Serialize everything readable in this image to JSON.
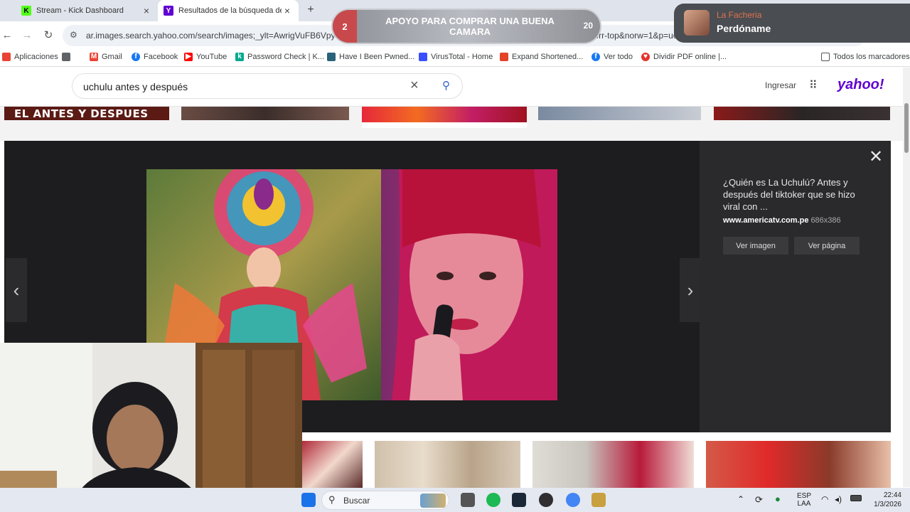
{
  "browser": {
    "tabs": [
      {
        "title": "Stream - Kick Dashboard",
        "favicon_color": "#53fc18",
        "favicon_glyph": "K"
      },
      {
        "title": "Resultados de la búsqueda de",
        "favicon_color": "#6001d2",
        "favicon_glyph": "Y"
      }
    ],
    "new_tab_glyph": "+",
    "close_glyph": "×",
    "url": "ar.images.search.yahoo.com/search/images;_ylt=AwrigVuFB6Vpye0...9Qt.?ei=UTF-8&type=E211AR1357G0&fr=mcafee&fr2=sp-qrw-corr-top&norw=1&p=uchulu+antes+...",
    "bookmarks": [
      {
        "label": "Aplicaciones",
        "icon": "apps-icon",
        "color": "#ea4335"
      },
      {
        "label": "",
        "icon": "grid-icon",
        "color": "#5f6368"
      },
      {
        "label": "Gmail",
        "icon": "gmail-icon",
        "color": "#ea4335"
      },
      {
        "label": "Facebook",
        "icon": "facebook-icon",
        "color": "#1877f2"
      },
      {
        "label": "YouTube",
        "icon": "youtube-icon",
        "color": "#ff0000"
      },
      {
        "label": "Password Check | K...",
        "icon": "kaspersky-icon",
        "color": "#00a88e"
      },
      {
        "label": "Have I Been Pwned...",
        "icon": "pwned-icon",
        "color": "#2a6379"
      },
      {
        "label": "VirusTotal - Home",
        "icon": "virustotal-icon",
        "color": "#394eff"
      },
      {
        "label": "Expand Shortened...",
        "icon": "expand-icon",
        "color": "#e24329"
      },
      {
        "label": "Ver todo",
        "icon": "facebook-icon",
        "color": "#1877f2"
      },
      {
        "label": "Dividir PDF online |...",
        "icon": "pdf-heart-icon",
        "color": "#e5322d"
      }
    ],
    "all_bookmarks": "Todos los marcadores"
  },
  "stream_overlay": {
    "goal_text": "APOYO PARA COMPRAR UNA BUENA CAMARA",
    "current": "2",
    "target": "20"
  },
  "notification": {
    "user": "La Facheria",
    "message": "Perdóname"
  },
  "yahoo": {
    "query": "uchulu antes y después",
    "signin": "Ingresar",
    "logo": "yahoo!",
    "strip_caption": "EL ANTES Y DESPUES"
  },
  "viewer": {
    "title": "¿Quién es La Uchulú? Antes y después del tiktoker que se hizo viral con ...",
    "source": "www.americatv.com.pe",
    "size": "686x386",
    "btn_view_image": "Ver imagen",
    "btn_view_page": "Ver página",
    "close_glyph": "✕",
    "prev_glyph": "‹",
    "next_glyph": "›"
  },
  "taskbar": {
    "search_label": "Buscar",
    "lang_top": "ESP",
    "lang_bottom": "LAA",
    "time": "22:44",
    "date": "1/3/2026"
  }
}
